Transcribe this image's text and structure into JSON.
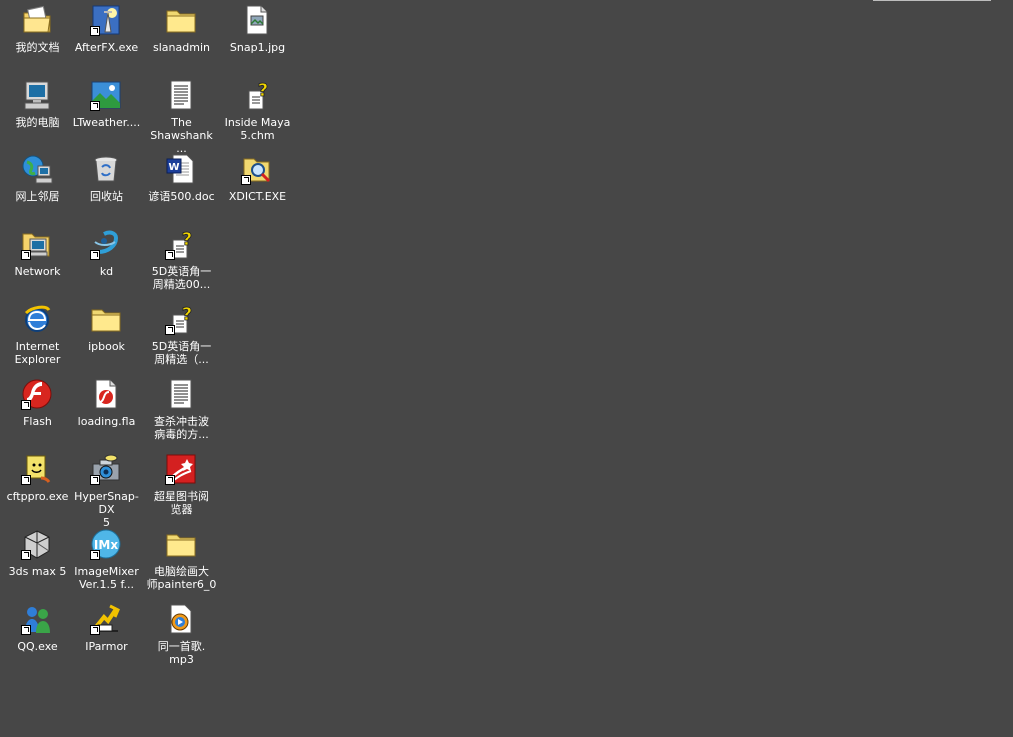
{
  "desktop": {
    "background": "#474747",
    "icons": [
      {
        "label": "我的文档",
        "icon": "my-documents-icon"
      },
      {
        "label": "AfterFX.exe",
        "icon": "afterfx-icon"
      },
      {
        "label": "slanadmin",
        "icon": "folder-icon"
      },
      {
        "label": "Snap1.jpg",
        "icon": "image-file-icon"
      },
      {
        "label": "我的电脑",
        "icon": "my-computer-icon"
      },
      {
        "label": "LTweather....",
        "icon": "landscape-icon"
      },
      {
        "label": "The\nShawshank ...",
        "icon": "text-document-icon"
      },
      {
        "label": "Inside Maya\n5.chm",
        "icon": "help-file-icon"
      },
      {
        "label": "网上邻居",
        "icon": "network-places-icon"
      },
      {
        "label": "回收站",
        "icon": "recycle-bin-icon"
      },
      {
        "label": "谚语500.doc",
        "icon": "word-document-icon"
      },
      {
        "label": "XDICT.EXE",
        "icon": "dictionary-app-icon"
      },
      {
        "label": "Network",
        "icon": "network-shortcut-icon"
      },
      {
        "label": "kd",
        "icon": "kd-app-icon"
      },
      {
        "label": "5D英语角一\n周精选00...",
        "icon": "help-file-icon"
      },
      {
        "label": "Internet\nExplorer",
        "icon": "internet-explorer-icon"
      },
      {
        "label": "ipbook",
        "icon": "folder-icon"
      },
      {
        "label": "5D英语角一\n周精选（...",
        "icon": "help-file-icon"
      },
      {
        "label": "Flash",
        "icon": "flash-icon"
      },
      {
        "label": "loading.fla",
        "icon": "fla-file-icon"
      },
      {
        "label": "查杀冲击波\n病毒的方...",
        "icon": "text-document-icon"
      },
      {
        "label": "cftppro.exe",
        "icon": "ftp-app-icon"
      },
      {
        "label": "HyperSnap-DX\n5",
        "icon": "camera-icon"
      },
      {
        "label": "超星图书阅\n览器",
        "icon": "superstar-reader-icon"
      },
      {
        "label": "3ds max 5",
        "icon": "3ds-max-icon"
      },
      {
        "label": "ImageMixer\nVer.1.5 f...",
        "icon": "imagemixer-icon"
      },
      {
        "label": "电脑绘画大\n师painter6_0",
        "icon": "folder-icon"
      },
      {
        "label": "QQ.exe",
        "icon": "qq-icon"
      },
      {
        "label": "IParmor",
        "icon": "iparmor-icon"
      },
      {
        "label": "同一首歌.\nmp3",
        "icon": "media-file-icon"
      }
    ]
  }
}
